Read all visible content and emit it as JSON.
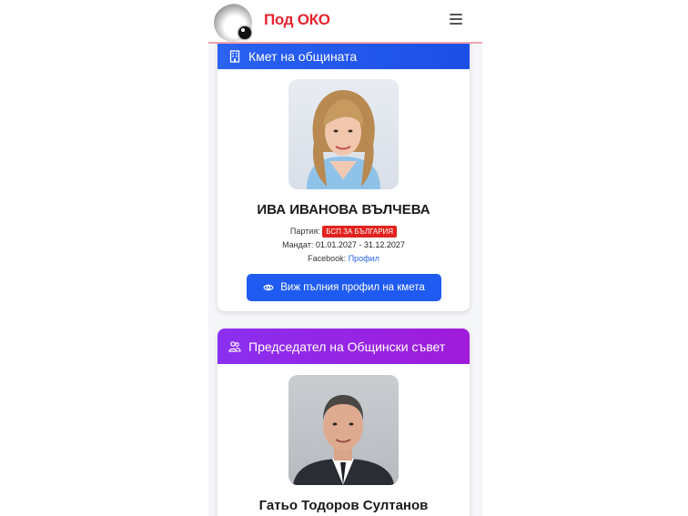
{
  "header": {
    "brand": "Под ОКО"
  },
  "mayor_card": {
    "heading": "Кмет на общината",
    "name": "ИВА ИВАНОВА ВЪЛЧЕВА",
    "party_label": "Партия:",
    "party_value": "БСП ЗА БЪЛГАРИЯ",
    "mandate_label": "Мандат:",
    "mandate_value": "01.01.2027 - 31.12.2027",
    "facebook_label": "Facebook:",
    "facebook_link": "Профил",
    "button_label": "Виж пълния профил на кмета"
  },
  "chair_card": {
    "heading": "Председател на Общински съвет",
    "name": "Гатьо Тодоров Султанов"
  },
  "colors": {
    "brand": "#e6232f",
    "mayor_header": "#1c4fe6",
    "chair_header": "#a01bd9",
    "badge": "#e1231f",
    "button": "#1f5bf0"
  },
  "icons": {
    "logo": "eye-logo",
    "menu": "hamburger-icon",
    "mayor": "building-icon",
    "chair": "users-icon",
    "button": "eye-icon"
  }
}
